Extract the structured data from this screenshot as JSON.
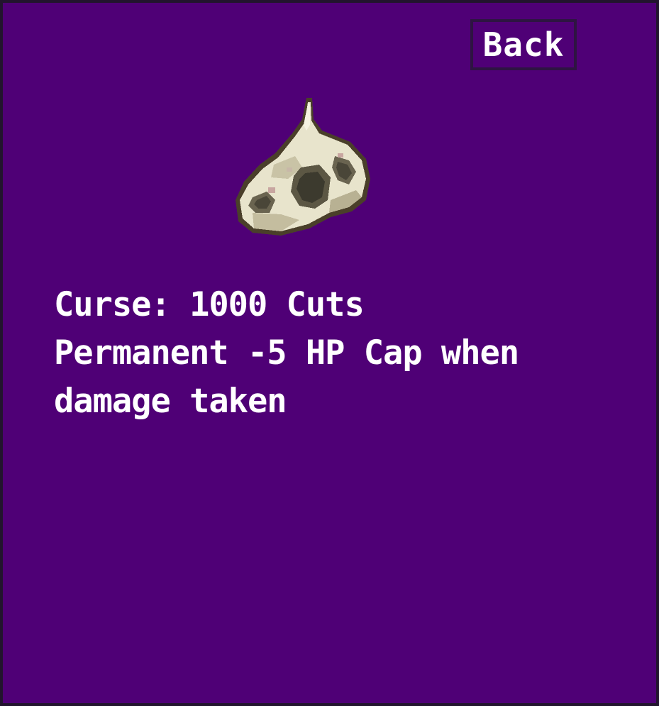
{
  "header": {
    "back_label": "Back"
  },
  "item": {
    "icon": "bone-skull-icon",
    "title": "Curse: 1000 Cuts",
    "description_line1": "Permanent -5 HP Cap when",
    "description_line2": "damage taken"
  },
  "colors": {
    "panel_background": "#4f0076",
    "border": "#22142e",
    "text": "#ffffff",
    "bone": "#e8e4cc",
    "bone_shadow": "#8c8468"
  }
}
